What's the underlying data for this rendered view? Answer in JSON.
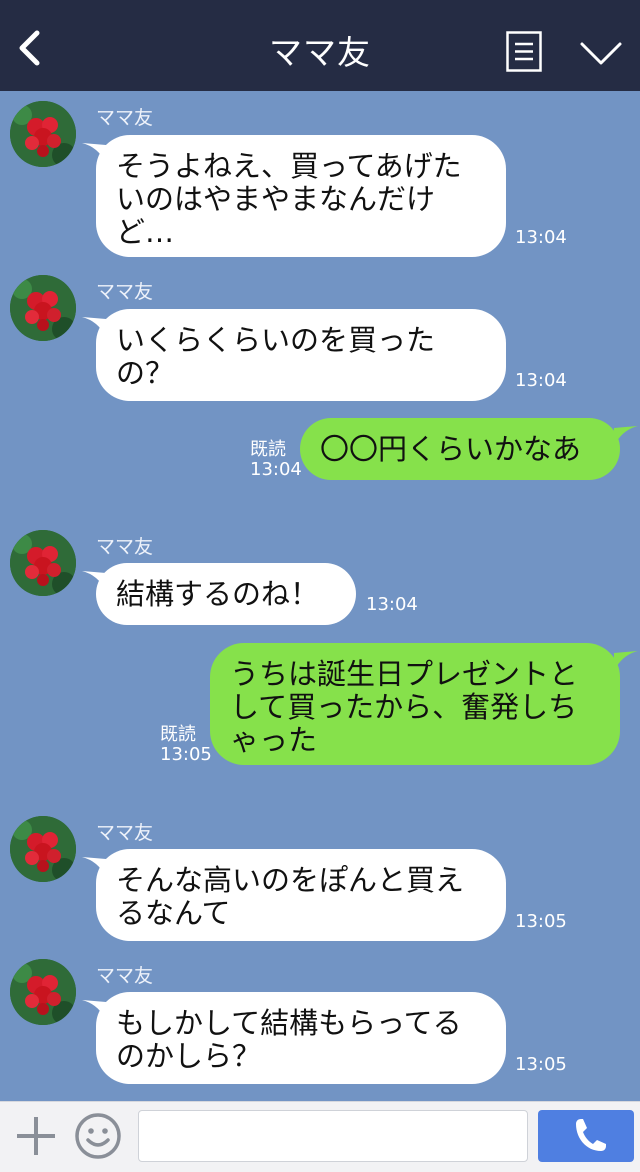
{
  "header": {
    "title": "ママ友"
  },
  "messages": [
    {
      "sender": "ママ友",
      "text": "そうよねえ、買ってあげたいのはやまやまなんだけど…",
      "time": "13:04"
    },
    {
      "sender": "ママ友",
      "text": "いくらくらいのを買ったの？",
      "time": "13:04"
    },
    {
      "read": "既読",
      "text": "〇〇円くらいかなあ",
      "time": "13:04"
    },
    {
      "sender": "ママ友",
      "text": "結構するのね！",
      "time": "13:04"
    },
    {
      "read": "既読",
      "text": "うちは誕生日プレゼントとして買ったから、奮発しちゃった",
      "time": "13:05"
    },
    {
      "sender": "ママ友",
      "text": "そんな高いのをぽんと買えるなんて",
      "time": "13:05"
    },
    {
      "sender": "ママ友",
      "text": "もしかして結構もらってるのかしら？",
      "time": "13:05"
    }
  ],
  "input": {
    "placeholder": "",
    "value": ""
  },
  "icons": {
    "back": "chevron-left-icon",
    "menu": "menu-icon",
    "collapse": "chevron-down-icon",
    "add": "plus-icon",
    "emoji": "smile-icon",
    "call": "phone-icon",
    "avatar": "flower-avatar"
  },
  "colors": {
    "header_bg": "#252c44",
    "chat_bg": "#7294c4",
    "bubble_left": "#ffffff",
    "bubble_right": "#86e14b",
    "send_button": "#4f7fe1"
  }
}
